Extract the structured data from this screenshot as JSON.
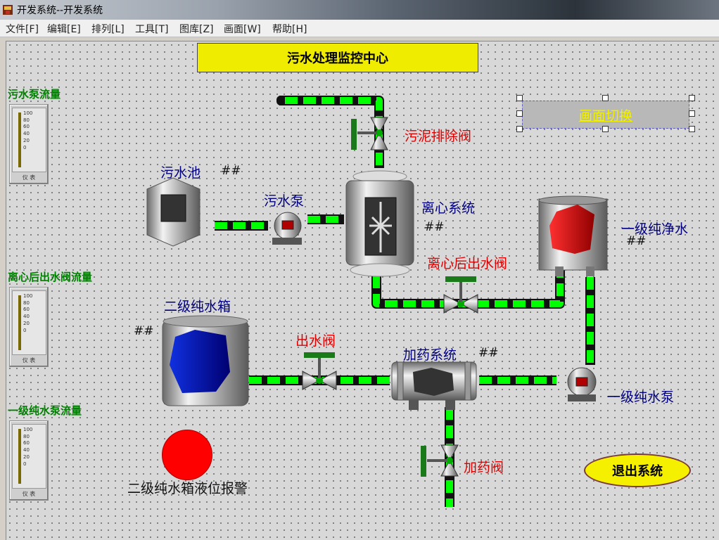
{
  "window": {
    "title": "开发系统--开发系统"
  },
  "menu": [
    "文件[F]",
    "编辑[E]",
    "排列[L]",
    "工具[T]",
    "图库[Z]",
    "画面[W]",
    "帮助[H]"
  ],
  "header": {
    "title": "污水处理监控中心"
  },
  "meters": [
    {
      "label": "污水泵流量",
      "ticks": [
        "100",
        "80",
        "60",
        "40",
        "20",
        "0"
      ],
      "caption": "仪 表"
    },
    {
      "label": "离心后出水阀流量",
      "ticks": [
        "100",
        "80",
        "60",
        "40",
        "20",
        "0"
      ],
      "caption": "仪 表"
    },
    {
      "label": "一级纯水泵流量",
      "ticks": [
        "100",
        "80",
        "60",
        "40",
        "20",
        "0"
      ],
      "caption": "仪 表"
    }
  ],
  "equipment": {
    "sludge_valve": "污泥排除阀",
    "sewage_pool": "污水池",
    "sewage_pool_value": "##",
    "sewage_pump": "污水泵",
    "centrifuge": "离心系统",
    "centrifuge_value": "##",
    "pure_water_1": "一级纯净水",
    "pure_water_1_value": "##",
    "outlet_valve_after_centrifuge": "离心后出水阀",
    "tank_2": "二级纯水箱",
    "tank_2_value": "##",
    "outlet_valve": "出水阀",
    "dosing_system": "加药系统",
    "dosing_system_value": "##",
    "pump_1": "一级纯水泵",
    "dosing_valve": "加药阀",
    "tank_2_alarm": "二级纯水箱液位报警"
  },
  "buttons": {
    "switch_screen": "画面切换",
    "exit": "退出系统"
  },
  "colors": {
    "pipe_green": "#00ff00",
    "header_yellow": "#f0ec00",
    "alarm_red": "#ff0000",
    "valve_handle": "#1a7a1a"
  }
}
